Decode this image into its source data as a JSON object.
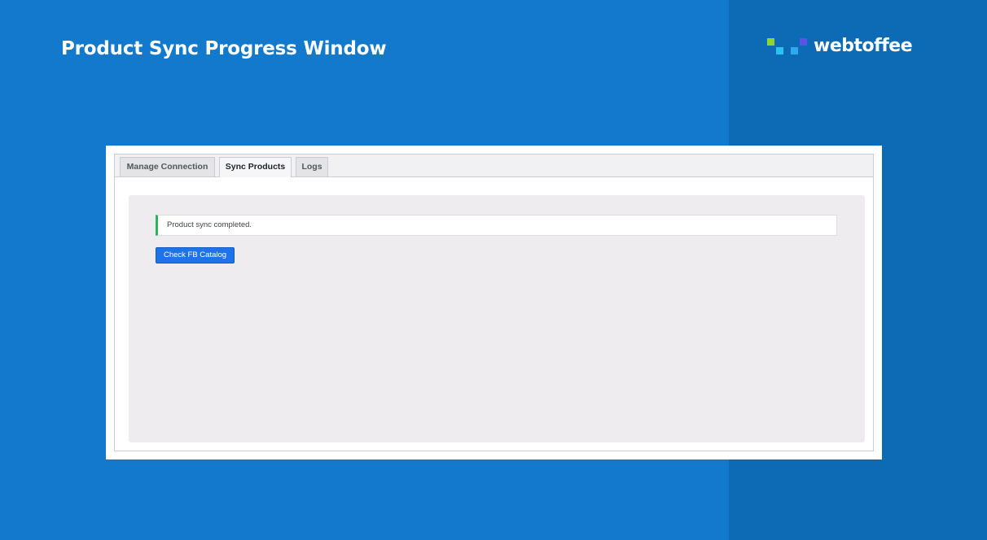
{
  "banner": {
    "title": "Product Sync Progress Window",
    "logo_text": "webtoffee"
  },
  "tabs": [
    {
      "label": "Manage Connection",
      "active": false
    },
    {
      "label": "Sync Products",
      "active": true
    },
    {
      "label": "Logs",
      "active": false
    }
  ],
  "notice": {
    "message": "Product sync completed.",
    "status": "success",
    "accent_color": "#2ab55c"
  },
  "actions": {
    "check_catalog_label": "Check FB Catalog"
  },
  "colors": {
    "background": "#1279cc",
    "background_right": "#0d6ab5",
    "button": "#1f73e8"
  },
  "icons": {
    "logo": "webtoffee-logo-icon"
  }
}
